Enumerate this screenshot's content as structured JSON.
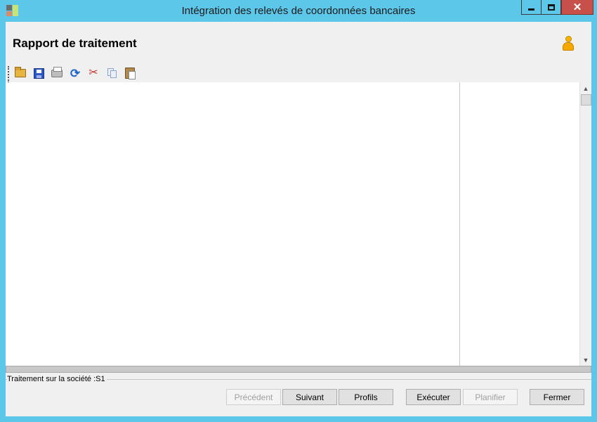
{
  "window": {
    "title": "Intégration des relevés de coordonnées bancaires",
    "controls": {
      "minimize_icon": "minimize-icon",
      "maximize_icon": "maximize-icon",
      "close_glyph": "✕"
    }
  },
  "header": {
    "title": "Rapport de traitement",
    "user_icon": "user-icon"
  },
  "toolbar": {
    "items": [
      "open-folder-icon",
      "save-icon",
      "print-icon",
      "refresh-icon",
      "cut-icon",
      "copy-icon",
      "paste-icon"
    ]
  },
  "report": {
    "content": "",
    "scroll_up_glyph": "▲",
    "scroll_down_glyph": "▼"
  },
  "status": {
    "text": "Traitement sur la société :S1"
  },
  "buttons": {
    "previous": "Précédent",
    "next": "Suivant",
    "profiles": "Profils",
    "execute": "Exécuter",
    "schedule": "Planifier",
    "close": "Fermer"
  },
  "colors": {
    "window_frame": "#5dc7ea",
    "client_bg": "#f0f0f0",
    "close_button": "#c7504b",
    "user_icon": "#f6a800"
  }
}
